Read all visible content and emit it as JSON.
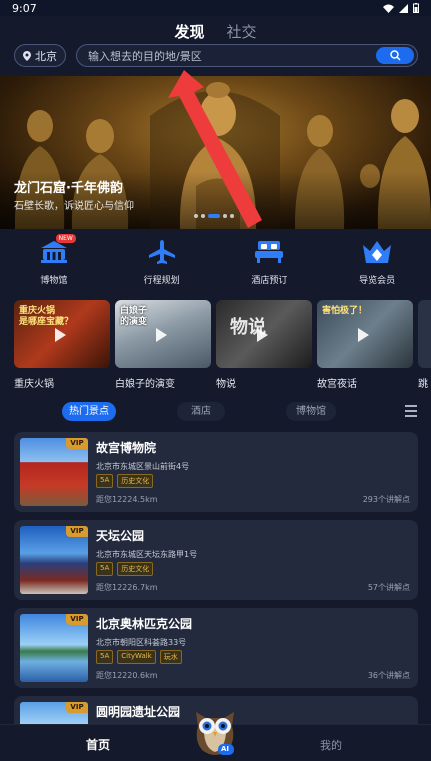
{
  "status": {
    "time": "9:07"
  },
  "header": {
    "tabs": [
      {
        "label": "发现",
        "active": true
      },
      {
        "label": "社交",
        "active": false
      }
    ],
    "city": "北京",
    "search_placeholder": "输入想去的目的地/景区"
  },
  "banner": {
    "title": "龙门石窟·千年佛韵",
    "subtitle": "石壁长歌，诉说匠心与信仰",
    "active_dot": 2,
    "dot_count": 5
  },
  "features": [
    {
      "label": "博物馆",
      "icon": "museum-icon",
      "badge": "NEW"
    },
    {
      "label": "行程规划",
      "icon": "airplane-icon"
    },
    {
      "label": "酒店预订",
      "icon": "hotel-bed-icon"
    },
    {
      "label": "导览会员",
      "icon": "crown-icon"
    }
  ],
  "videos": [
    {
      "title": "重庆火锅",
      "overlay": "重庆火锅\n是哪座宝藏？"
    },
    {
      "title": "白娘子的演变",
      "overlay": "白娘子\n的演变"
    },
    {
      "title": "物说",
      "overlay": "物说"
    },
    {
      "title": "故宫夜话",
      "overlay": "害怕极了！"
    },
    {
      "title": "跳",
      "overlay": ""
    }
  ],
  "categories": [
    {
      "label": "热门景点",
      "active": true
    },
    {
      "label": "酒店",
      "active": false
    },
    {
      "label": "博物馆",
      "active": false
    }
  ],
  "attractions": [
    {
      "name": "故宫博物院",
      "address": "北京市东城区景山前街4号",
      "tags": [
        "5A",
        "历史文化"
      ],
      "distance": "距您12224.5km",
      "count": "293个讲解点",
      "vip": "VIP"
    },
    {
      "name": "天坛公园",
      "address": "北京市东城区天坛东路甲1号",
      "tags": [
        "5A",
        "历史文化"
      ],
      "distance": "距您12226.7km",
      "count": "57个讲解点",
      "vip": "VIP"
    },
    {
      "name": "北京奥林匹克公园",
      "address": "北京市朝阳区科荟路33号",
      "tags": [
        "5A",
        "CityWalk",
        "玩水"
      ],
      "distance": "距您12220.6km",
      "count": "36个讲解点",
      "vip": "VIP"
    },
    {
      "name": "圆明园遗址公园",
      "address": "",
      "tags": [],
      "distance": "",
      "count": "",
      "vip": "VIP"
    }
  ],
  "bottom_nav": {
    "home": "首页",
    "mine": "我的",
    "ai_badge": "AI"
  },
  "colors": {
    "accent": "#1d6cf0",
    "background": "#141a2c",
    "card": "#232a3d",
    "vip": "#d89b2f",
    "annotation_arrow": "#ee3b3b"
  }
}
